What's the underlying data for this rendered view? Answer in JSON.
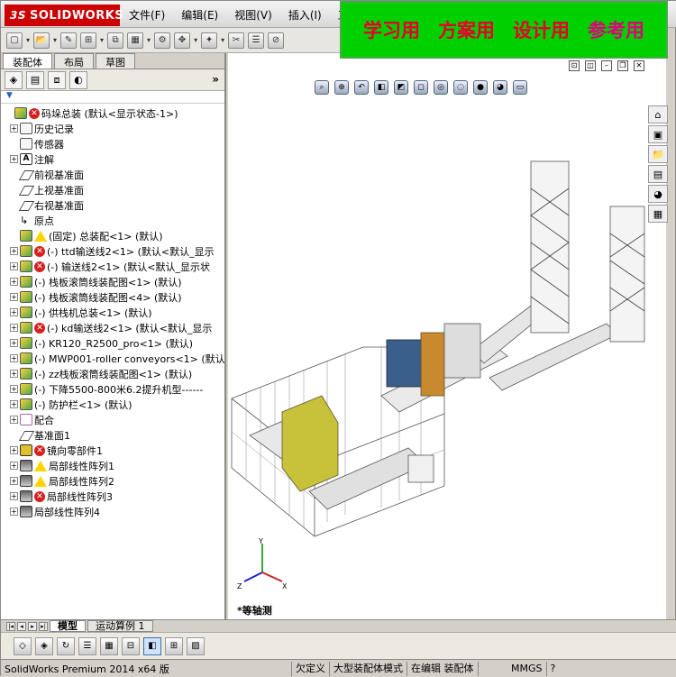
{
  "app": {
    "logo_text": "SOLIDWORKS",
    "logo_prefix": "3S",
    "menus": [
      "文件(F)",
      "编辑(E)",
      "视图(V)",
      "插入(I)",
      "工具"
    ],
    "banner": [
      "学习用",
      "方案用",
      "设计用",
      "参考用"
    ]
  },
  "panel": {
    "tabs": [
      "装配体",
      "布局",
      "草图"
    ],
    "expand_label": "»",
    "tree": [
      {
        "label": "码垛总装  (默认<显示状态-1>)",
        "icon": "assembly-icon",
        "status": "error",
        "exp": "",
        "indent": 0
      },
      {
        "label": "历史记录",
        "icon": "history-icon",
        "status": "",
        "exp": "+",
        "indent": 1
      },
      {
        "label": "传感器",
        "icon": "sensor-icon",
        "status": "",
        "exp": "",
        "indent": 1
      },
      {
        "label": "注解",
        "icon": "annotation-icon",
        "status": "",
        "exp": "+",
        "indent": 1
      },
      {
        "label": "前视基准面",
        "icon": "plane-icon",
        "status": "",
        "exp": "",
        "indent": 1
      },
      {
        "label": "上视基准面",
        "icon": "plane-icon",
        "status": "",
        "exp": "",
        "indent": 1
      },
      {
        "label": "右视基准面",
        "icon": "plane-icon",
        "status": "",
        "exp": "",
        "indent": 1
      },
      {
        "label": "原点",
        "icon": "origin-icon",
        "status": "",
        "exp": "",
        "indent": 1
      },
      {
        "label": "(固定) 总装配<1> (默认)",
        "icon": "assembly-icon",
        "status": "warning",
        "exp": "",
        "indent": 1
      },
      {
        "label": "(-) ttd输送线2<1> (默认<默认_显示",
        "icon": "assembly-icon",
        "status": "error",
        "exp": "+",
        "indent": 1
      },
      {
        "label": "(-) 输送线2<1> (默认<默认_显示状",
        "icon": "assembly-icon",
        "status": "error",
        "exp": "+",
        "indent": 1
      },
      {
        "label": "(-) 栈板滚筒线装配图<1> (默认)",
        "icon": "assembly-icon",
        "status": "",
        "exp": "+",
        "indent": 1
      },
      {
        "label": "(-) 栈板滚筒线装配图<4> (默认)",
        "icon": "assembly-icon",
        "status": "",
        "exp": "+",
        "indent": 1
      },
      {
        "label": "(-) 供栈机总装<1> (默认)",
        "icon": "assembly-icon",
        "status": "",
        "exp": "+",
        "indent": 1
      },
      {
        "label": "(-) kd输送线2<1> (默认<默认_显示",
        "icon": "assembly-icon",
        "status": "error",
        "exp": "+",
        "indent": 1
      },
      {
        "label": "(-) KR120_R2500_pro<1> (默认)",
        "icon": "assembly-icon",
        "status": "",
        "exp": "+",
        "indent": 1
      },
      {
        "label": "(-) MWP001-roller conveyors<1> (默认",
        "icon": "assembly-icon",
        "status": "",
        "exp": "+",
        "indent": 1
      },
      {
        "label": "(-) zz栈板滚筒线装配图<1> (默认)",
        "icon": "assembly-icon",
        "status": "",
        "exp": "+",
        "indent": 1
      },
      {
        "label": "(-) 下降5500-800米6.2提升机型------",
        "icon": "assembly-icon",
        "status": "",
        "exp": "+",
        "indent": 1
      },
      {
        "label": "(-) 防护栏<1> (默认)",
        "icon": "assembly-icon",
        "status": "",
        "exp": "+",
        "indent": 1
      },
      {
        "label": "配合",
        "icon": "mate-icon",
        "status": "",
        "exp": "+",
        "indent": 1
      },
      {
        "label": "基准面1",
        "icon": "plane-icon",
        "status": "",
        "exp": "",
        "indent": 1
      },
      {
        "label": "镜向零部件1",
        "icon": "mirror-icon",
        "status": "error",
        "exp": "+",
        "indent": 1
      },
      {
        "label": "局部线性阵列1",
        "icon": "pattern-icon",
        "status": "warning",
        "exp": "+",
        "indent": 1
      },
      {
        "label": "局部线性阵列2",
        "icon": "pattern-icon",
        "status": "warning",
        "exp": "+",
        "indent": 1
      },
      {
        "label": "局部线性阵列3",
        "icon": "pattern-icon",
        "status": "error",
        "exp": "+",
        "indent": 1
      },
      {
        "label": "局部线性阵列4",
        "icon": "pattern-icon",
        "status": "",
        "exp": "+",
        "indent": 1
      }
    ]
  },
  "viewport": {
    "view_label": "*等轴测"
  },
  "model_tabs": [
    "模型",
    "运动算例 1"
  ],
  "status": {
    "product": "SolidWorks Premium 2014 x64 版",
    "cells": [
      "欠定义",
      "大型装配体模式",
      "在编辑 装配体",
      "MMGS",
      "?"
    ]
  }
}
